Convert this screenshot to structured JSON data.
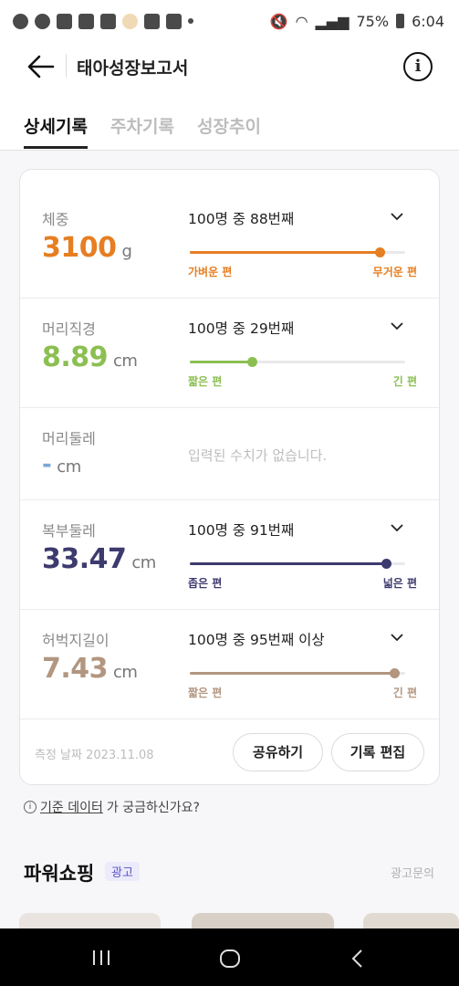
{
  "status_bar": {
    "battery": "75%",
    "time": "6:04"
  },
  "header": {
    "title": "태아성장보고서"
  },
  "tabs": [
    {
      "label": "상세기록",
      "active": true
    },
    {
      "label": "주차기록",
      "active": false
    },
    {
      "label": "성장추이",
      "active": false
    }
  ],
  "measurements": [
    {
      "name": "체중",
      "value": "3100",
      "unit": "g",
      "rank": "100명 중 88번째",
      "low_label": "가벼운 편",
      "high_label": "무거운 편",
      "percent": 0.88,
      "color": "#e67e22"
    },
    {
      "name": "머리직경",
      "value": "8.89",
      "unit": "cm",
      "rank": "100명 중 29번째",
      "low_label": "짧은 편",
      "high_label": "긴 편",
      "percent": 0.29,
      "color": "#8cbf52"
    },
    {
      "name": "머리둘레",
      "value": "-",
      "unit": "cm",
      "empty_text": "입력된 수치가 없습니다.",
      "color": "#7aa7d8"
    },
    {
      "name": "복부둘레",
      "value": "33.47",
      "unit": "cm",
      "rank": "100명 중 91번째",
      "low_label": "좁은 편",
      "high_label": "넓은 편",
      "percent": 0.91,
      "color": "#3d3a6e"
    },
    {
      "name": "허벅지길이",
      "value": "7.43",
      "unit": "cm",
      "rank": "100명 중 95번째 이상",
      "low_label": "짧은 편",
      "high_label": "긴 편",
      "percent": 0.95,
      "color": "#b29680"
    }
  ],
  "footer": {
    "date": "측정 날짜 2023.11.08",
    "share_label": "공유하기",
    "edit_label": "기록 편집"
  },
  "help": {
    "link": "기준 데이터",
    "rest": "가 궁금하신가요?"
  },
  "power_shopping": {
    "title": "파워쇼핑",
    "badge": "광고",
    "inquiry": "광고문의"
  }
}
